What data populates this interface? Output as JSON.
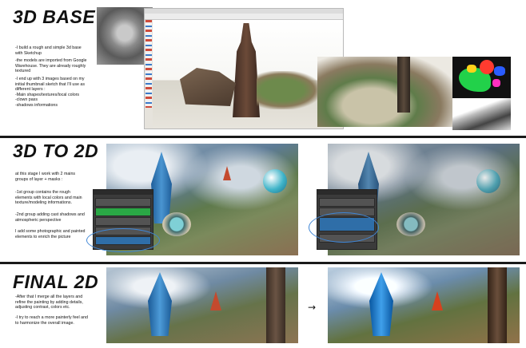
{
  "sections": [
    {
      "title": "3D BASE",
      "paragraphs": [
        "-I build a rough and simple 3d base\nwith Sketchup",
        "-the models are imported from Google\nWarehouse. They are already roughly\ntextured",
        "-I end up with 3 images based on my\ninitial thumbnail sketch that I'll use as\ndifferent layers :\n   -Main shapes/textures/local colors\n   -clown pass\n   -shadows informations"
      ]
    },
    {
      "title": "3D TO 2D",
      "paragraphs": [
        "at this stage I work with 2 mains\ngroups of layer + masks :",
        "-1st group contains the rough\nelements with local colors and main\ntexture/modeling informations.",
        "-2nd group adding cast shadows and\natmospheric perspective",
        "I add some photographic and painted\nelements to enrich the picture"
      ]
    },
    {
      "title": "FINAL 2D",
      "paragraphs": [
        "-After that I merge all the layers and\nrefine the painting by adding details,\nadjusting contrast, colors etc.",
        "-I try to reach a more painterly feel and\nto harmonize the overall image."
      ]
    }
  ],
  "arrow": "→",
  "colors": {
    "divider": "#1a1a1a",
    "highlight_ellipse": "#3f86d6",
    "panel_bg": "#3b3b3b"
  }
}
